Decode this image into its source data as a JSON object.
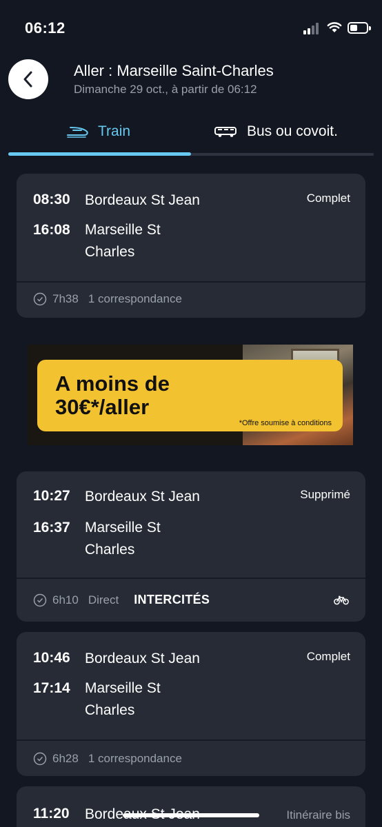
{
  "status_bar": {
    "time": "06:12"
  },
  "header": {
    "title": "Aller : Marseille Saint-Charles",
    "subtitle": "Dimanche 29 oct., à partir de 06:12"
  },
  "tabs": [
    {
      "label": "Train",
      "icon": "train-icon",
      "active": true
    },
    {
      "label": "Bus ou covoit.",
      "icon": "bus-icon",
      "active": false
    }
  ],
  "journeys": [
    {
      "departure_time": "08:30",
      "departure_station": "Bordeaux St Jean",
      "arrival_time": "16:08",
      "arrival_station_line1": "Marseille St",
      "arrival_station_line2": "Charles",
      "status": "Complet",
      "duration": "7h38",
      "connections": "1 correspondance"
    },
    {
      "departure_time": "10:27",
      "departure_station": "Bordeaux St Jean",
      "arrival_time": "16:37",
      "arrival_station_line1": "Marseille St",
      "arrival_station_line2": "Charles",
      "status": "Supprimé",
      "duration": "6h10",
      "connections": "Direct",
      "brand": "INTERCITÉS",
      "bike_icon": "bicycle-icon"
    },
    {
      "departure_time": "10:46",
      "departure_station": "Bordeaux St Jean",
      "arrival_time": "17:14",
      "arrival_station_line1": "Marseille St",
      "arrival_station_line2": "Charles",
      "status": "Complet",
      "duration": "6h28",
      "connections": "1 correspondance"
    },
    {
      "departure_time": "11:20",
      "departure_station": "Bordeaux St Jean",
      "status": "Itinéraire bis"
    }
  ],
  "banner": {
    "headline_line1": "A moins de",
    "headline_line2": "30€*/aller",
    "fine_print": "*Offre soumise à conditions"
  },
  "colors": {
    "background": "#121722",
    "card": "#262b35",
    "accent": "#67c8f0",
    "banner_yellow": "#f2c230",
    "muted_text": "#9aa0ab"
  }
}
